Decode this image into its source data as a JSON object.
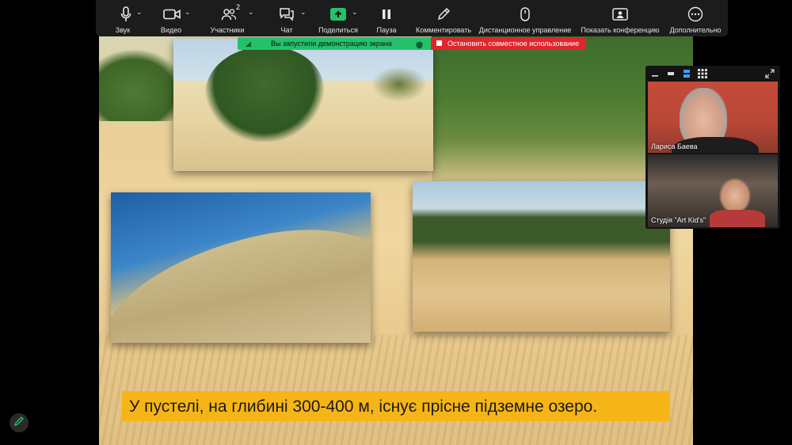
{
  "toolbar": {
    "audio": {
      "label": "Звук",
      "icon": "microphone-icon"
    },
    "video": {
      "label": "Видео",
      "icon": "video-camera-icon"
    },
    "participants": {
      "label": "Участники",
      "count": "2",
      "icon": "participants-icon"
    },
    "chat": {
      "label": "Чат",
      "icon": "chat-icon"
    },
    "share": {
      "label": "Поделиться",
      "icon": "share-screen-icon",
      "accent": "#23c26a"
    },
    "pause": {
      "label": "Пауза",
      "icon": "pause-icon"
    },
    "annotate": {
      "label": "Комментировать",
      "icon": "pencil-icon"
    },
    "remote": {
      "label": "Дистанционное управление",
      "icon": "mouse-icon"
    },
    "show_conference": {
      "label": "Показать конференцию",
      "icon": "gallery-icon"
    },
    "more": {
      "label": "Дополнительно",
      "icon": "more-icon"
    }
  },
  "share_banner": {
    "status": "Вы запустили демонстрацию экрана",
    "stop": "Остановить совместное использование",
    "status_color": "#23c26a",
    "stop_color": "#e0252d"
  },
  "video_panel": {
    "participants": [
      {
        "name": "Лариса Баева"
      },
      {
        "name": "Студія \"Art Kid's\""
      }
    ]
  },
  "slide": {
    "caption": "У пустелі, на глибині 300-400 м, існує прісне підземне озеро.",
    "caption_bg": "#f6b516"
  }
}
